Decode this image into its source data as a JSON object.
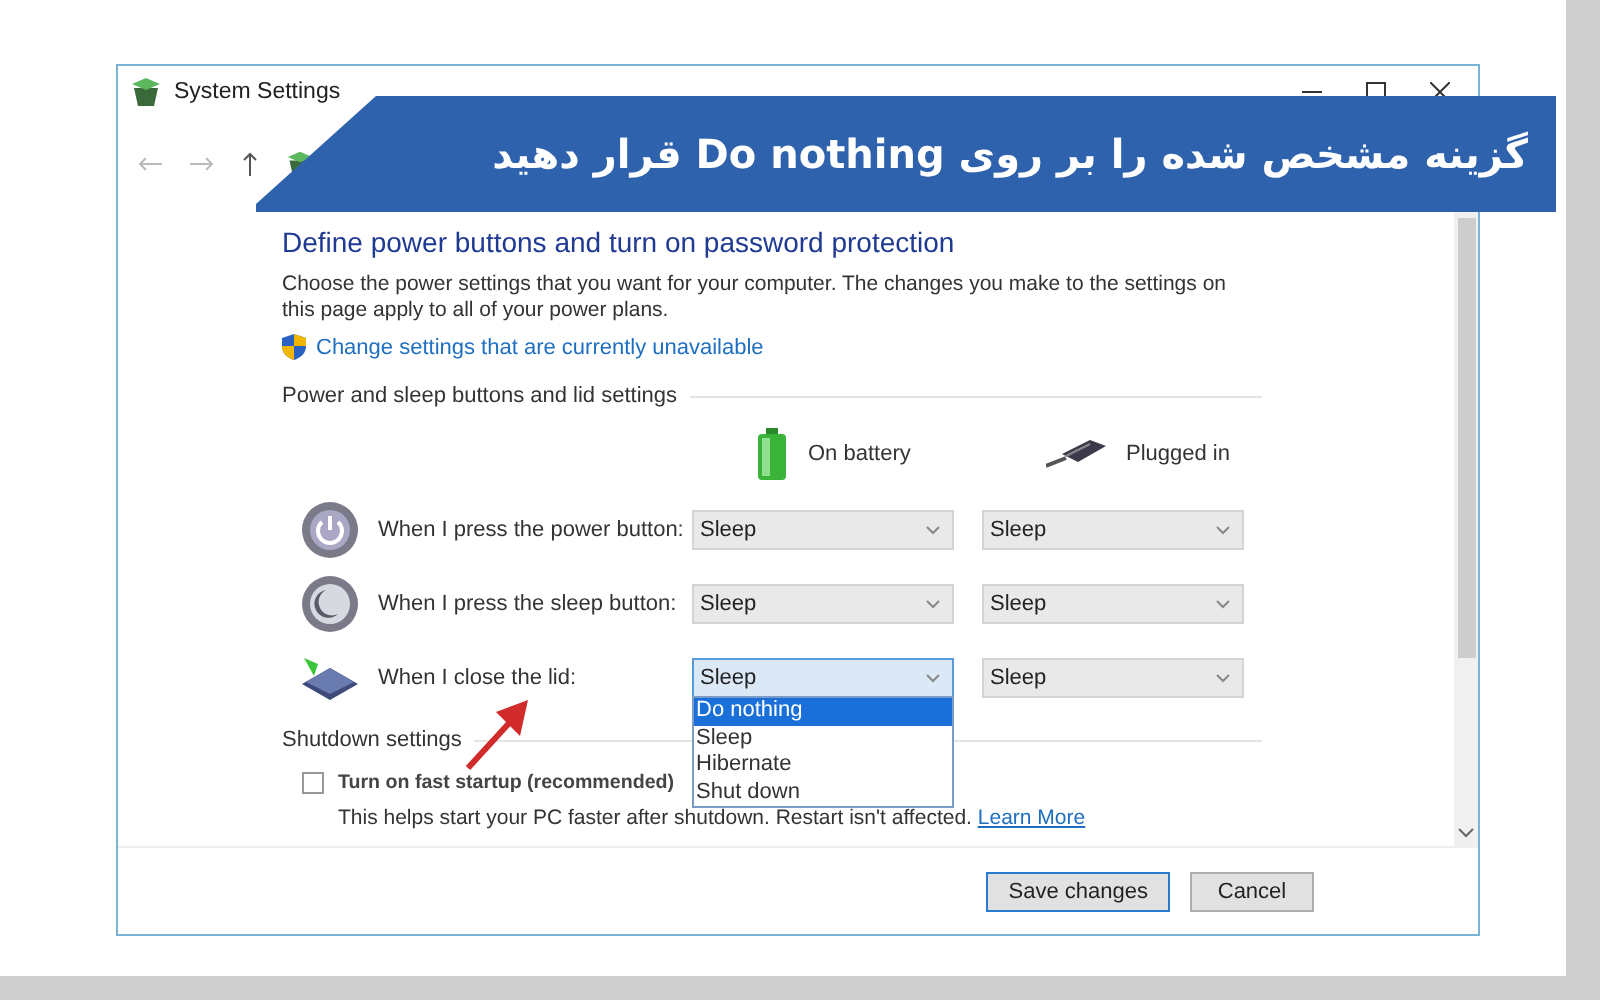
{
  "window": {
    "title": "System Settings"
  },
  "banner": {
    "text": "گزینه مشخص شده را بر روی Do nothing قرار دهید"
  },
  "heading": "Define power buttons and turn on password protection",
  "description": "Choose the power settings that you want for your computer. The changes you make to the settings on this page apply to all of your power plans.",
  "admin_link": "Change settings that are currently unavailable",
  "section": "Power and sleep buttons and lid settings",
  "columns": [
    {
      "kind": "battery",
      "label": "On battery"
    },
    {
      "kind": "plug",
      "label": "Plugged in"
    }
  ],
  "rows": [
    {
      "kind": "power",
      "label": "When I press the power button:",
      "values": [
        "Sleep",
        "Sleep"
      ],
      "focused": false
    },
    {
      "kind": "sleep",
      "label": "When I press the sleep button:",
      "values": [
        "Sleep",
        "Sleep"
      ],
      "focused": false
    },
    {
      "kind": "lid",
      "label": "When I close the lid:",
      "values": [
        "Sleep",
        "Sleep"
      ],
      "focused": true
    }
  ],
  "dropdown": {
    "options": [
      {
        "label": "Do nothing",
        "selected": true
      },
      {
        "label": "Sleep",
        "selected": false
      },
      {
        "label": "Hibernate",
        "selected": false
      },
      {
        "label": "Shut down",
        "selected": false
      }
    ]
  },
  "shutdown": {
    "title": "Shutdown settings",
    "fast_startup": {
      "label": "Turn on fast startup (recommended)",
      "checked": false,
      "help": "This helps start your PC faster after shutdown. Restart isn't affected.",
      "link": "Learn More"
    }
  },
  "buttons": [
    {
      "label": "Save changes",
      "default": true
    },
    {
      "label": "Cancel",
      "default": false
    }
  ]
}
